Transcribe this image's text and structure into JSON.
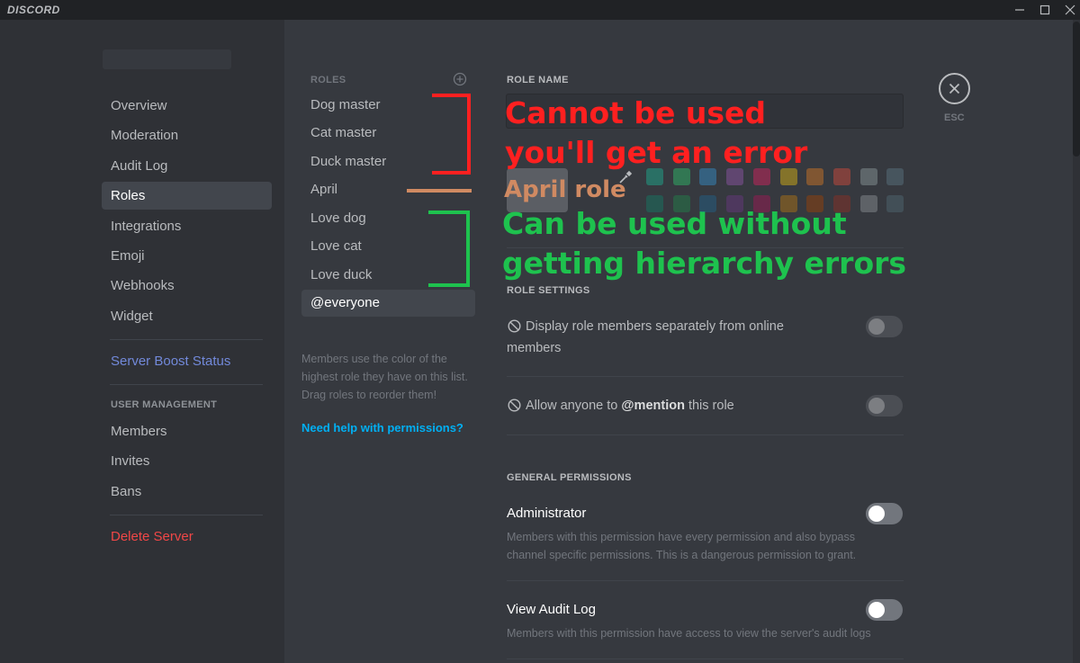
{
  "app": {
    "brand": "DISCORD"
  },
  "colors": {
    "window_bg": "#36393f",
    "sidebar_bg": "#2f3136",
    "titlebar_bg": "#202225",
    "boost": "#7289da",
    "danger": "#f04747",
    "link": "#00b0f4",
    "annotation_red": "#ff2020",
    "annotation_green": "#1ec24e",
    "annotation_orange": "#d08a62"
  },
  "sidebar": {
    "items": [
      {
        "label": "Overview"
      },
      {
        "label": "Moderation"
      },
      {
        "label": "Audit Log"
      },
      {
        "label": "Roles",
        "selected": true
      },
      {
        "label": "Integrations"
      },
      {
        "label": "Emoji"
      },
      {
        "label": "Webhooks"
      },
      {
        "label": "Widget"
      }
    ],
    "boost_label": "Server Boost Status",
    "user_management_header": "USER MANAGEMENT",
    "user_management_items": [
      {
        "label": "Members"
      },
      {
        "label": "Invites"
      },
      {
        "label": "Bans"
      }
    ],
    "delete_label": "Delete Server"
  },
  "roles": {
    "header": "ROLES",
    "list": [
      {
        "label": "Dog master"
      },
      {
        "label": "Cat master"
      },
      {
        "label": "Duck master"
      },
      {
        "label": "April"
      },
      {
        "label": "Love dog"
      },
      {
        "label": "Love cat"
      },
      {
        "label": "Love duck"
      },
      {
        "label": "@everyone",
        "selected": true
      }
    ],
    "note": "Members use the color of the highest role they have on this list. Drag roles to reorder them!",
    "help_link": "Need help with permissions?"
  },
  "main": {
    "role_name_label": "ROLE NAME",
    "role_name_value": "",
    "swatch_colors": [
      [
        "#1abc9c",
        "#2ecc71",
        "#3498db",
        "#9b59b6",
        "#e91e63",
        "#f1c40f",
        "#e67e22",
        "#e74c3c",
        "#95a5a6",
        "#607d8b"
      ],
      [
        "#11806a",
        "#1f8b4c",
        "#206694",
        "#71368a",
        "#ad1457",
        "#c27c0e",
        "#a84300",
        "#992d22",
        "#979c9f",
        "#546e7a"
      ]
    ],
    "role_settings_label": "ROLE SETTINGS",
    "display_separately": {
      "line1": "Display role members separately from online",
      "line2": "members"
    },
    "mention": {
      "prefix": "Allow anyone to ",
      "bold": "@mention",
      "suffix": " this role"
    },
    "general_permissions_label": "GENERAL PERMISSIONS",
    "administrator": {
      "title": "Administrator",
      "desc_line1": "Members with this permission have every permission and also bypass",
      "desc_line2": "channel specific permissions. This is a dangerous permission to grant."
    },
    "view_audit_log": {
      "title": "View Audit Log",
      "desc": "Members with this permission have access to view the server's audit logs"
    }
  },
  "close": {
    "label": "ESC"
  },
  "annotations": {
    "cannot_line1": "Cannot be used",
    "cannot_line2": "you'll get an error",
    "april_role": "April role",
    "can_line1": "Can be used without",
    "can_line2": "getting hierarchy errors"
  }
}
